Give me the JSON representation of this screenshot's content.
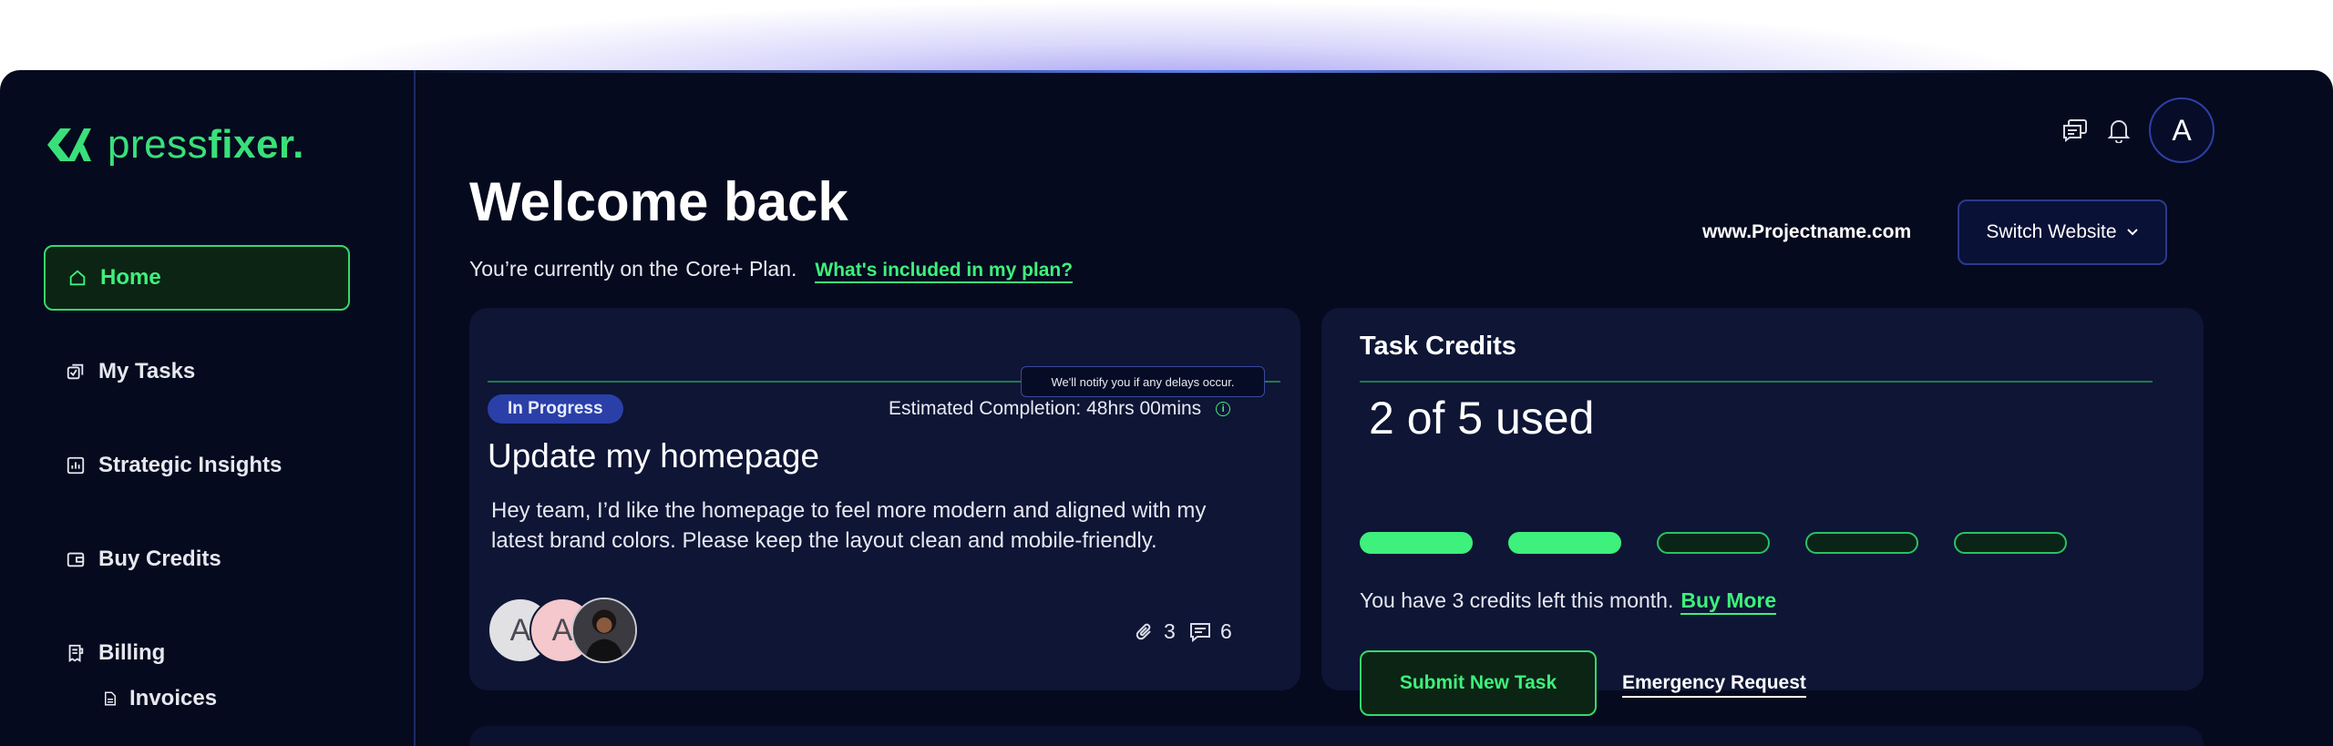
{
  "brand": {
    "name_light": "press",
    "name_bold": "fixer."
  },
  "sidebar": {
    "items": [
      {
        "label": "Home",
        "icon": "home-icon",
        "active": true
      },
      {
        "label": "My Tasks",
        "icon": "tasks-icon"
      },
      {
        "label": "Strategic Insights",
        "icon": "chart-icon"
      },
      {
        "label": "Buy Credits",
        "icon": "wallet-icon"
      },
      {
        "label": "Billing",
        "icon": "billing-icon"
      }
    ],
    "subitems": [
      {
        "label": "Invoices",
        "icon": "document-icon"
      }
    ]
  },
  "header": {
    "avatar_initial": "A",
    "title": "Welcome back",
    "plan_prefix": "You’re currently on the",
    "plan_name": "Core+ Plan.",
    "plan_link": "What's included in my plan?",
    "website": "www.Projectname.com",
    "switch_label": "Switch Website"
  },
  "task_card": {
    "tooltip": "We'll notify you if any delays occur.",
    "status": "In Progress",
    "estimate": "Estimated Completion: 48hrs 00mins",
    "title": "Update my homepage",
    "description": "Hey team, I’d like the homepage to feel more modern and aligned with my latest brand colors. Please keep the layout clean and mobile-friendly.",
    "avatars": [
      "A",
      "A"
    ],
    "attachments": "3",
    "comments": "6"
  },
  "credits_card": {
    "title": "Task Credits",
    "used_text": "2 of 5 used",
    "used": 2,
    "total": 5,
    "left_text": "You have 3 credits left this month.",
    "buy_more": "Buy More",
    "submit_label": "Submit New Task",
    "emergency_label": "Emergency Request"
  },
  "colors": {
    "accent": "#3ef07c",
    "background": "#050a1e",
    "card": "#0e1535",
    "badge": "#2a3fa8"
  }
}
